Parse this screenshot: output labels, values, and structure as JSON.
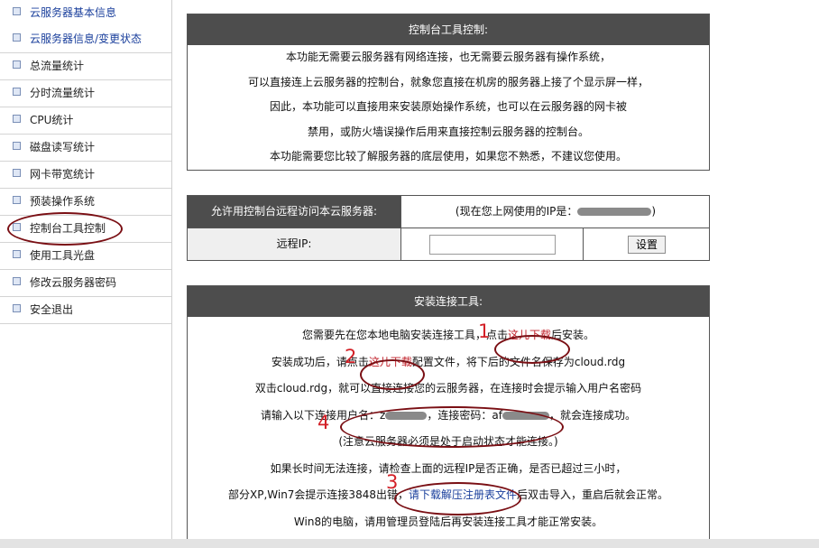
{
  "sidebar": {
    "groups": [
      [
        {
          "label": "云服务器基本信息"
        },
        {
          "label": "云服务器信息/变更状态"
        }
      ],
      [
        {
          "label": "总流量统计"
        },
        {
          "label": "分时流量统计"
        },
        {
          "label": "CPU统计"
        },
        {
          "label": "磁盘读写统计"
        },
        {
          "label": "网卡带宽统计"
        },
        {
          "label": "预装操作系统"
        },
        {
          "label": "控制台工具控制"
        },
        {
          "label": "使用工具光盘"
        },
        {
          "label": "修改云服务器密码"
        },
        {
          "label": "安全退出"
        }
      ]
    ]
  },
  "intro": {
    "title": "控制台工具控制:",
    "lines": [
      "本功能无需要云服务器有网络连接，也无需要云服务器有操作系统，",
      "可以直接连上云服务器的控制台，就象您直接在机房的服务器上接了个显示屏一样，",
      "因此，本功能可以直接用来安装原始操作系统，也可以在云服务器的网卡被",
      "禁用，或防火墙误操作后用来直接控制云服务器的控制台。",
      "本功能需要您比较了解服务器的底层使用，如果您不熟悉，不建议您使用。"
    ]
  },
  "access": {
    "allow_label": "允许用控制台远程访问本云服务器:",
    "current_ip_prefix": "(现在您上网使用的IP是：",
    "current_ip_suffix": ")",
    "remote_ip_label": "远程IP:",
    "remote_ip_value": "",
    "set_button": "设置"
  },
  "install": {
    "title": "安装连接工具:",
    "line1_a": "您需要先在您本地电脑安装连接工具，点击",
    "line1_link": "这儿下载",
    "line1_b": "后安装。",
    "line2_a": "安装成功后，请点击",
    "line2_link": "这儿下载",
    "line2_b": "配置文件，将下后的文件名保存为cloud.rdg",
    "line3": "双击cloud.rdg，就可以直接连接您的云服务器，在连接时会提示输入用户名密码",
    "line4_a": "请输入以下连接用户名：",
    "line4_user": "z",
    "line4_b": "，连接密码：",
    "line4_pass": "af",
    "line4_c": "，就会连接成功。",
    "line5": "(注意云服务器必须是处于启动状态才能连接。)",
    "line6": "如果长时间无法连接，请检查上面的远程IP是否正确，是否已超过三小时，",
    "line7_a": "部分XP,Win7会提示连接3848出错，",
    "line7_link": "请下载解压注册表文件",
    "line7_b": "后双击导入，重启后就会正常。",
    "line8": "Win8的电脑，请用管理员登陆后再安装连接工具才能正常安装。"
  },
  "annotations": {
    "n1": "1",
    "n2": "2",
    "n3": "3",
    "n4": "4"
  }
}
